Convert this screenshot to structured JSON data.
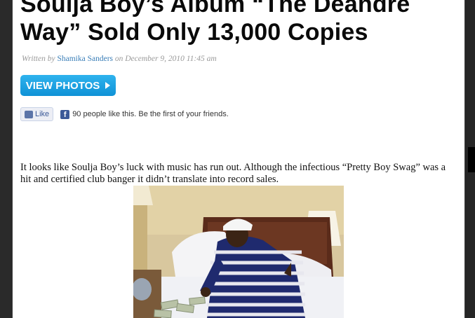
{
  "article": {
    "title": "Soulja Boy’s Album “The Deandre Way” Sold Only 13,000 Copies",
    "byline_prefix": "Written by",
    "author": "Shamika Sanders",
    "byline_mid": "on",
    "date": "December 9, 2010 11:45 am",
    "view_photos_label": "VIEW PHOTOS",
    "body_text": "It looks like Soulja Boy’s luck with music has run out. Although the infectious “Pretty Boy Swag” was a hit and certified club banger it didn’t translate into record sales."
  },
  "social": {
    "like_label": "Like",
    "like_text": "90 people like this. Be the first of your friends.",
    "fb_glyph": "f"
  },
  "icons": {
    "thumb": "thumbs-up-icon",
    "facebook": "facebook-icon",
    "arrow": "play-arrow-icon"
  },
  "colors": {
    "button_blue": "#1aa3e3",
    "author_link": "#3b7fb8",
    "facebook_blue": "#3b5998"
  }
}
